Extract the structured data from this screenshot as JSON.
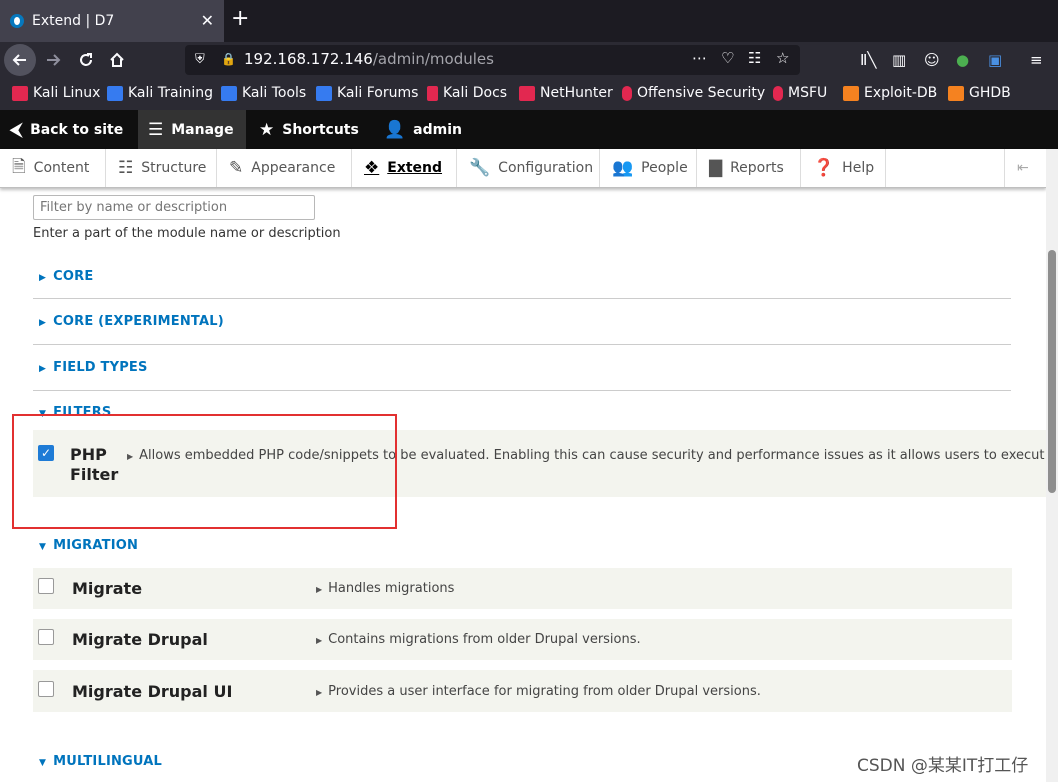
{
  "browser": {
    "tab_title": "Extend | D7",
    "close_tab": "✕",
    "new_tab": "+",
    "url_host": "192.168.172.146",
    "url_path": "/admin/modules",
    "bookmarks": [
      {
        "label": "Kali Linux",
        "color": "#367bf0"
      },
      {
        "label": "Kali Training",
        "color": "#367bf0"
      },
      {
        "label": "Kali Tools",
        "color": "#367bf0"
      },
      {
        "label": "Kali Forums",
        "color": "#367bf0"
      },
      {
        "label": "Kali Docs",
        "color": "#e22850"
      },
      {
        "label": "NetHunter",
        "color": "#367bf0"
      },
      {
        "label": "Offensive Security",
        "color": "#e22850"
      },
      {
        "label": "MSFU",
        "color": "#e22850"
      },
      {
        "label": "Exploit-DB",
        "color": "#f58220"
      },
      {
        "label": "GHDB",
        "color": "#f58220"
      }
    ]
  },
  "admin_toolbar": {
    "back_to_site": "Back to site",
    "manage": "Manage",
    "shortcuts": "Shortcuts",
    "user": "admin"
  },
  "tray": {
    "items": [
      "Content",
      "Structure",
      "Appearance",
      "Extend",
      "Configuration",
      "People",
      "Reports",
      "Help"
    ],
    "active": "Extend"
  },
  "filter": {
    "placeholder": "Filter by name or description",
    "hint": "Enter a part of the module name or description"
  },
  "sections": {
    "core": "CORE",
    "core_experimental": "CORE (EXPERIMENTAL)",
    "field_types": "FIELD TYPES",
    "filters": "FILTERS",
    "migration": "MIGRATION",
    "multilingual": "MULTILINGUAL"
  },
  "modules": {
    "php_filter": {
      "name_line1": "PHP",
      "name_line2": "Filter",
      "checked": true,
      "description": "Allows embedded PHP code/snippets to be evaluated. Enabling this can cause security and performance issues as it allows users to execut"
    },
    "migrate": {
      "name": "Migrate",
      "checked": false,
      "description": "Handles migrations"
    },
    "migrate_drupal": {
      "name": "Migrate Drupal",
      "checked": false,
      "description": "Contains migrations from older Drupal versions."
    },
    "migrate_drupal_ui": {
      "name": "Migrate Drupal UI",
      "checked": false,
      "description": "Provides a user interface for migrating from older Drupal versions."
    }
  },
  "watermark": "CSDN @某某IT打工仔"
}
